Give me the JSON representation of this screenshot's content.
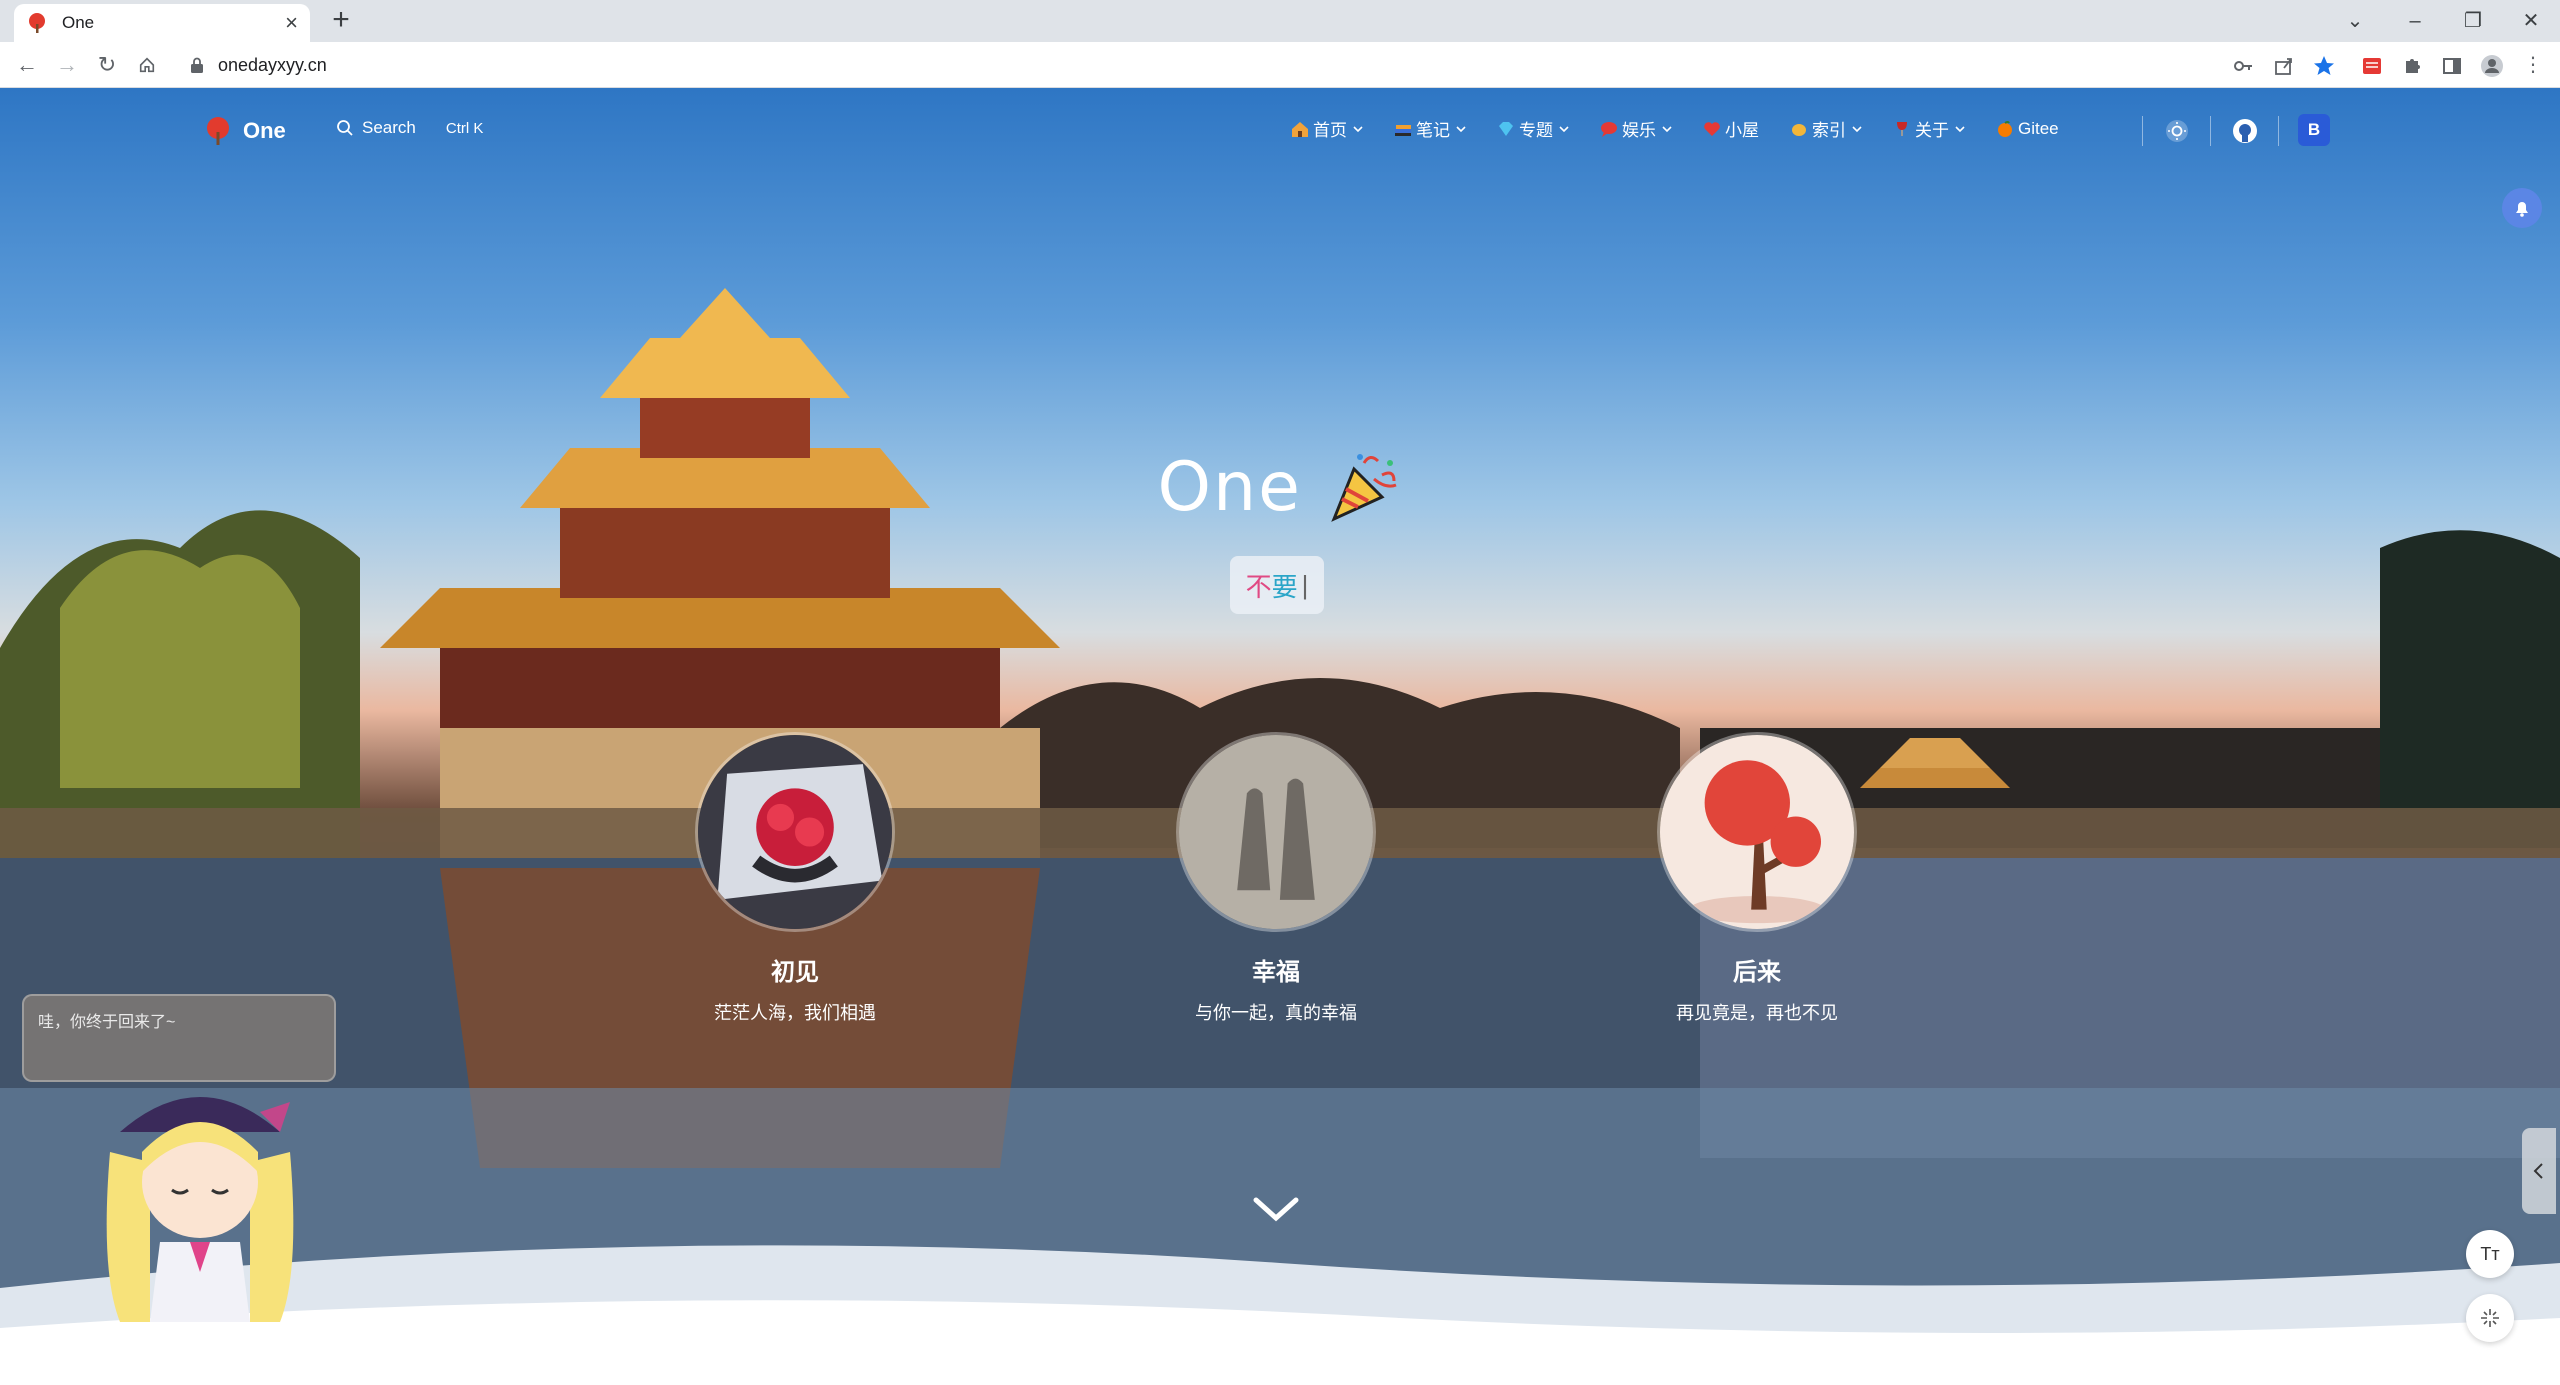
{
  "browser": {
    "tab_title": "One",
    "url": "onedayxyy.cn"
  },
  "site": {
    "logo_text": "One",
    "search_label": "Search",
    "search_shortcut": "Ctrl K",
    "nav": [
      {
        "label": "首页"
      },
      {
        "label": "笔记"
      },
      {
        "label": "专题"
      },
      {
        "label": "娱乐"
      },
      {
        "label": "小屋"
      },
      {
        "label": "索引"
      },
      {
        "label": "关于"
      },
      {
        "label": "Gitee"
      }
    ],
    "avatar_letter": "B"
  },
  "hero": {
    "title": "One",
    "typing_char_1": "不",
    "typing_char_2": "要",
    "typing_cursor": "|"
  },
  "cards": [
    {
      "title": "初见",
      "desc": "茫茫人海，我们相遇"
    },
    {
      "title": "幸福",
      "desc": "与你一起，真的幸福"
    },
    {
      "title": "后来",
      "desc": "再见竟是，再也不见"
    }
  ],
  "chat_bubble": "哇，你终于回来了~",
  "float_buttons": {
    "font_size_label": "Tт"
  },
  "colors": {
    "accent": "#2a5bd7",
    "sky_top": "#2e76c4",
    "sunset": "#eab8a0"
  }
}
